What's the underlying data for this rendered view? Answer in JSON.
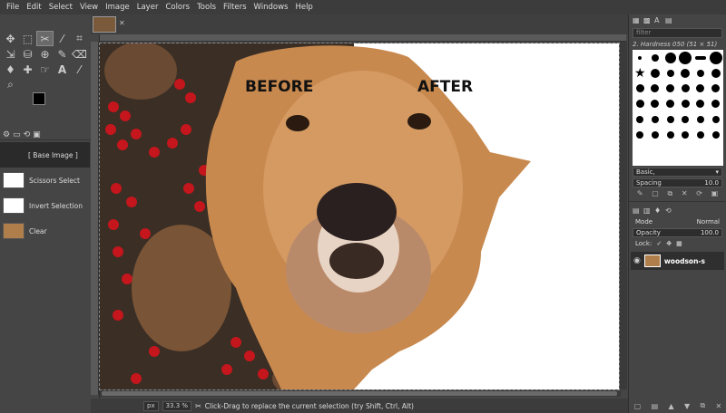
{
  "menu": [
    "File",
    "Edit",
    "Select",
    "View",
    "Image",
    "Layer",
    "Colors",
    "Tools",
    "Filters",
    "Windows",
    "Help"
  ],
  "tools": [
    "move-icon",
    "rect-select-icon",
    "scissors-select-icon",
    "fuzzy-select-icon",
    "crop-icon",
    "transform-icon",
    "paint-bucket-icon",
    "clone-icon",
    "paintbrush-icon",
    "eraser-icon",
    "paths-icon",
    "heal-icon",
    "smudge-icon",
    "text-icon",
    "color-picker-icon",
    "zoom-icon"
  ],
  "history": {
    "items": [
      "[ Base Image ]",
      "Scissors Select",
      "Invert Selection",
      "Clear"
    ]
  },
  "canvas": {
    "before_label": "BEFORE",
    "after_label": "AFTER"
  },
  "status": {
    "unit": "px",
    "zoom": "33.3 %",
    "message": "Click-Drag to replace the current selection (try Shift, Ctrl, Alt)"
  },
  "brushes": {
    "filter_placeholder": "filter",
    "current_brush": "2. Hardness 050 (51 × 51)",
    "preset": "Basic,",
    "spacing_label": "Spacing",
    "spacing_value": "10.0"
  },
  "layers": {
    "mode_label": "Mode",
    "mode_value": "Normal",
    "opacity_label": "Opacity",
    "opacity_value": "100.0",
    "lock_label": "Lock:",
    "layer_name": "woodson-s"
  }
}
